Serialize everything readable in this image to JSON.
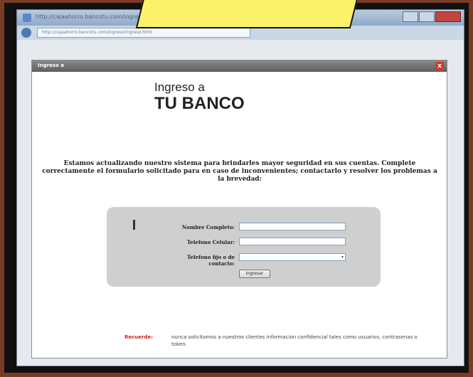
{
  "browser": {
    "title": "http://cajaahorro.bancotu.com/ingreso/ingreso.html - Windows Internet Explorer",
    "url": "http://cajaahorro.bancotu.com/ingreso/ingreso.html"
  },
  "dialog": {
    "title": "Ingreso a",
    "close_label": "x"
  },
  "brand": {
    "line1": "Ingreso a",
    "line2": "TU BANCO"
  },
  "notice": "Estamos actualizando nuestro sistema para brindarles mayor seguridad en sus cuentas. Complete correctamente el formulario solicitado para en caso de inconvenientes; contactarlo y resolver los problemas a la brevedad:",
  "form": {
    "name_label": "Nombre Completo:",
    "cell_label": "Telefono Celular:",
    "phone_label": "Telefono fijo o de contacto:",
    "submit_label": "Ingresar"
  },
  "reminder": {
    "label": "Recuerde:",
    "text": "nunca solicitamos a nuestros clientes informacion confidencial tales como usuarios, contrasenas o token."
  },
  "colors": {
    "reminder_label": "#c8271f",
    "caption": "#fbf26a"
  }
}
